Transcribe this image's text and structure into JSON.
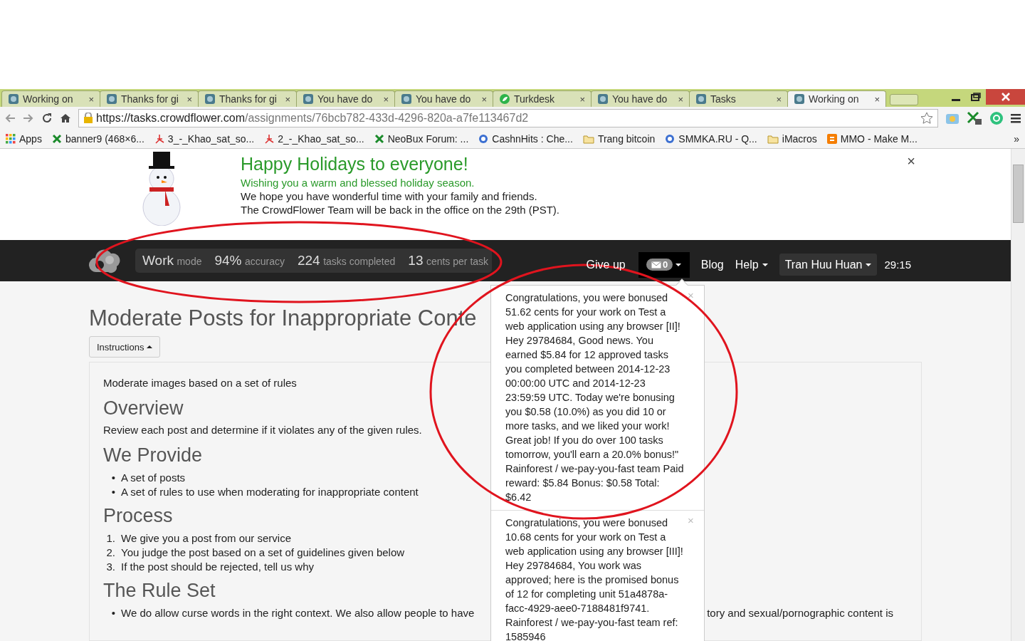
{
  "browser": {
    "tabs": [
      {
        "title": "Working on",
        "selected": false,
        "kind": "site",
        "close": "×"
      },
      {
        "title": "Thanks for gi",
        "selected": false,
        "kind": "site",
        "close": "×"
      },
      {
        "title": "Thanks for gi",
        "selected": false,
        "kind": "site",
        "close": "×"
      },
      {
        "title": "You have do",
        "selected": false,
        "kind": "site",
        "close": "×"
      },
      {
        "title": "You have do",
        "selected": false,
        "kind": "site",
        "close": "×"
      },
      {
        "title": "Turkdesk",
        "selected": false,
        "kind": "green",
        "close": "×"
      },
      {
        "title": "You have do",
        "selected": false,
        "kind": "site",
        "close": "×"
      },
      {
        "title": "Tasks",
        "selected": false,
        "kind": "site",
        "close": "×"
      },
      {
        "title": "Working on",
        "selected": true,
        "kind": "site",
        "close": "×"
      }
    ],
    "url_host": "https://tasks.crowdflower.com",
    "url_path": "/assignments/76bcb782-433d-4296-820a-a7fe113467d2",
    "bookmarks": [
      {
        "label": "Apps",
        "kind": "apps"
      },
      {
        "label": "banner9 (468×6...",
        "kind": "cross"
      },
      {
        "label": "3_-_Khao_sat_so...",
        "kind": "pdf"
      },
      {
        "label": "2_-_Khao_sat_so...",
        "kind": "pdf"
      },
      {
        "label": "NeoBux Forum: ...",
        "kind": "cross"
      },
      {
        "label": "CashnHits : Che...",
        "kind": "site"
      },
      {
        "label": "Trang bitcoin",
        "kind": "folder"
      },
      {
        "label": "SMMKA.RU - Q...",
        "kind": "site"
      },
      {
        "label": "iMacros",
        "kind": "folder"
      },
      {
        "label": "MMO - Make M...",
        "kind": "blog"
      }
    ],
    "more": "»"
  },
  "banner": {
    "title": "Happy Holidays to everyone!",
    "subtitle": "Wishing you a warm and blessed holiday season.",
    "lines": [
      "We hope you have wonderful time with your family and friends.",
      "The CrowdFlower Team will be back in the office on the 29th (PST)."
    ],
    "close": "×"
  },
  "navbar": {
    "stats": [
      {
        "amount": "Work",
        "unit": "mode"
      },
      {
        "amount": "94%",
        "unit": "accuracy"
      },
      {
        "amount": "224",
        "unit": "tasks completed"
      },
      {
        "amount": "13",
        "unit": "cents per task"
      }
    ],
    "give_up": "Give up",
    "messages_count": "0",
    "links": [
      {
        "label": "Blog",
        "dropdown": false,
        "boxed": false
      },
      {
        "label": "Help",
        "dropdown": true,
        "boxed": false
      },
      {
        "label": "Tran Huu Huan",
        "dropdown": true,
        "boxed": true
      }
    ],
    "timer": "29:15"
  },
  "notifications": [
    {
      "text": "Congratulations, you were bonused 51.62 cents for your work on Test a web application using any browser [II]! Hey 29784684, Good news. You earned $5.84 for 12 approved tasks you completed between 2014-12-23 00:00:00 UTC and 2014-12-23 23:59:59 UTC. Today we're bonusing you $0.58 (10.0%) as you did 10 or more tasks, and we liked your work! Great job! If you do over 100 tasks tomorrow, you'll earn a 20.0% bonus!\" Rainforest / we-pay-you-fast team Paid reward: $5.84 Bonus: $0.58 Total: $6.42",
      "close": "×"
    },
    {
      "text": "Congratulations, you were bonused 10.68 cents for your work on Test a web application using any browser [III]! Hey 29784684, You work was approved; here is the promised bonus of 12 for completing unit 51a4878a-facc-4929-aee0-7188481f9741. Rainforest / we-pay-you-fast team ref: 1585946",
      "close": "×"
    }
  ],
  "page": {
    "title": "Moderate Posts for Inappropriate Conte",
    "instructions": "Instructions",
    "intro": "Moderate images based on a set of rules",
    "sections": [
      {
        "heading": "Overview",
        "kind": "paragraph",
        "items": [
          "Review each post and determine if it violates any of the given rules."
        ]
      },
      {
        "heading": "We Provide",
        "kind": "list",
        "items": [
          {
            "marker": "•",
            "text": "A set of posts"
          },
          {
            "marker": "•",
            "text": "A set of rules to use when moderating for inappropriate content"
          }
        ]
      },
      {
        "heading": "Process",
        "kind": "list",
        "items": [
          {
            "marker": "1.",
            "text": "We give you a post from our service"
          },
          {
            "marker": "2.",
            "text": "You judge the post based on a set of guidelines given below"
          },
          {
            "marker": "3.",
            "text": "If the post should be rejected, tell us why"
          }
        ]
      },
      {
        "heading": "The Rule Set",
        "kind": "split",
        "items": [
          {
            "marker": "•",
            "text": "We do allow curse words in the right context. We also allow people to have"
          },
          {
            "marker": "",
            "text": "tory and sexual/pornographic content is"
          }
        ]
      }
    ]
  }
}
